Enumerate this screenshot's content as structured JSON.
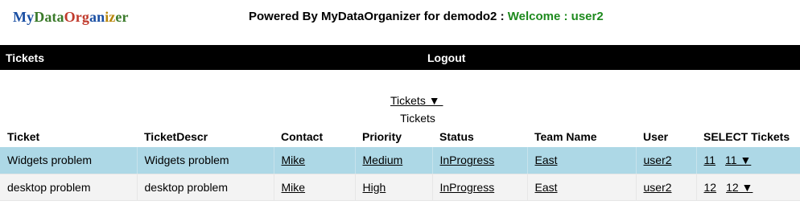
{
  "logo": {
    "letters": [
      "M",
      "y",
      "D",
      "a",
      "t",
      "a",
      "O",
      "r",
      "g",
      "a",
      "n",
      "i",
      "z",
      "e",
      "r"
    ],
    "colors": [
      "#1a4fa3",
      "#1a4fa3",
      "#3a7a2a",
      "#3a7a2a",
      "#3a7a2a",
      "#3a7a2a",
      "#c0392b",
      "#c0392b",
      "#c0392b",
      "#1a4fa3",
      "#1a4fa3",
      "#b8860b",
      "#b8860b",
      "#3a7a2a",
      "#3a7a2a"
    ]
  },
  "header": {
    "powered_text": "Powered By MyDataOrganizer for demodo2 :",
    "welcome_text": "Welcome : user2",
    "welcome_color": "#1e8a1e"
  },
  "nav": {
    "tickets_label": "Tickets",
    "logout_label": "Logout"
  },
  "view": {
    "dropdown_label": "Tickets ▼ ",
    "section_title": "Tickets"
  },
  "table": {
    "columns": [
      "Ticket",
      "TicketDescr",
      "Contact",
      "Priority",
      "Status",
      "Team Name",
      "User",
      "SELECT Tickets"
    ],
    "rows": [
      {
        "ticket": "Widgets problem",
        "descr": "Widgets problem",
        "contact": "Mike",
        "priority": "Medium",
        "status": "InProgress",
        "team": "East",
        "user": "user2",
        "select_id": "11",
        "select_menu": "11 ▼"
      },
      {
        "ticket": "desktop problem",
        "descr": "desktop problem",
        "contact": "Mike",
        "priority": "High",
        "status": "InProgress",
        "team": "East",
        "user": "user2",
        "select_id": "12",
        "select_menu": "12 ▼"
      }
    ]
  }
}
